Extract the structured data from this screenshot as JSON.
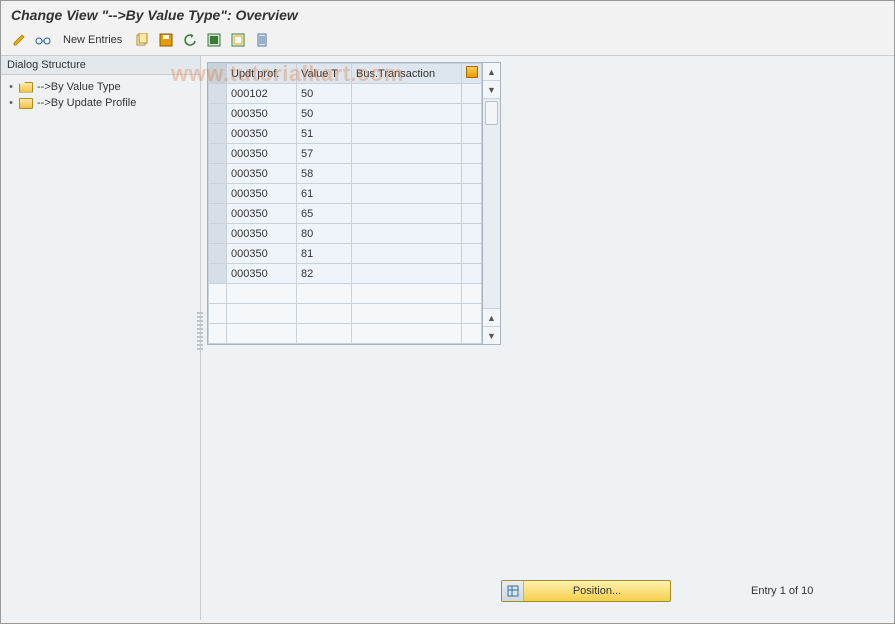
{
  "title": "Change View \"-->By Value Type\": Overview",
  "toolbar": {
    "new_entries_label": "New Entries"
  },
  "watermark": "www.tutorialkart.com",
  "sidebar": {
    "header": "Dialog Structure",
    "items": [
      {
        "label": "-->By Value Type",
        "open": true
      },
      {
        "label": "-->By Update Profile",
        "open": false
      }
    ]
  },
  "grid": {
    "columns": [
      "Updt prof.",
      "Value T",
      "Bus.Transaction"
    ],
    "rows": [
      {
        "updt": "000102",
        "valt": "50",
        "bus": ""
      },
      {
        "updt": "000350",
        "valt": "50",
        "bus": ""
      },
      {
        "updt": "000350",
        "valt": "51",
        "bus": ""
      },
      {
        "updt": "000350",
        "valt": "57",
        "bus": ""
      },
      {
        "updt": "000350",
        "valt": "58",
        "bus": ""
      },
      {
        "updt": "000350",
        "valt": "61",
        "bus": ""
      },
      {
        "updt": "000350",
        "valt": "65",
        "bus": ""
      },
      {
        "updt": "000350",
        "valt": "80",
        "bus": ""
      },
      {
        "updt": "000350",
        "valt": "81",
        "bus": ""
      },
      {
        "updt": "000350",
        "valt": "82",
        "bus": ""
      }
    ],
    "empty_rows": 3
  },
  "bottom": {
    "position_label": "Position...",
    "entry_text": "Entry 1 of 10"
  }
}
